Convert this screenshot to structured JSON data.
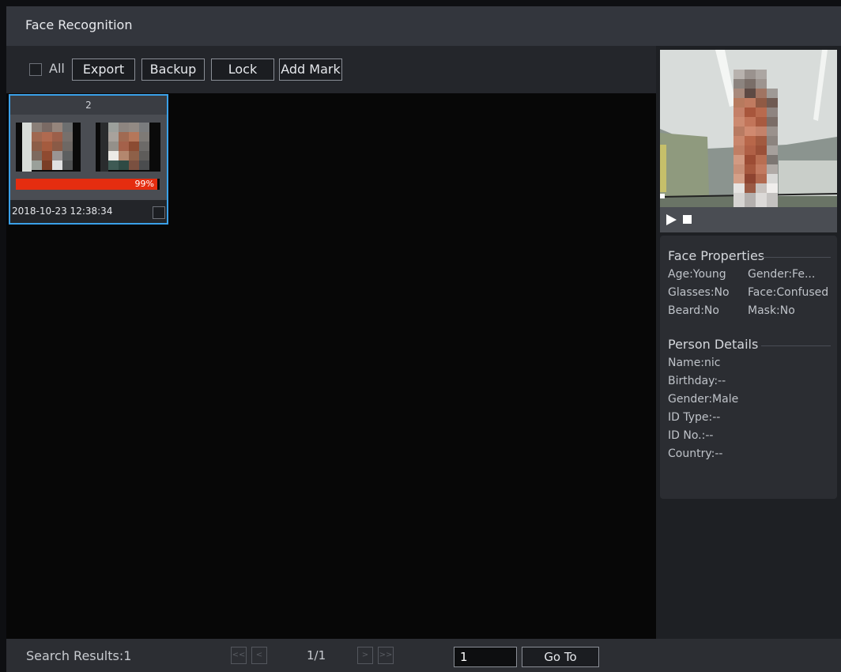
{
  "header": {
    "title": "Face Recognition"
  },
  "toolbar": {
    "all_label": "All",
    "export_label": "Export",
    "backup_label": "Backup",
    "lock_label": "Lock",
    "add_mark_label": "Add Mark"
  },
  "results": {
    "cards": [
      {
        "index": "2",
        "similarity": "99%",
        "similarity_fraction": 0.99,
        "timestamp": "2018-10-23 12:38:34"
      }
    ]
  },
  "preview": {
    "controls": [
      "play-icon",
      "stop-icon"
    ]
  },
  "face_properties": {
    "title": "Face Properties",
    "age": "Age:Young",
    "gender": "Gender:Fe...",
    "glasses": "Glasses:No",
    "face": "Face:Confused",
    "beard": "Beard:No",
    "mask": "Mask:No"
  },
  "person_details": {
    "title": "Person Details",
    "name": "Name:nic",
    "birthday": "Birthday:--",
    "gender": "Gender:Male",
    "id_type": "ID Type:--",
    "id_no": "ID No.:--",
    "country": "Country:--"
  },
  "footer": {
    "search_results": "Search Results:1",
    "first": "<<",
    "prev": "<",
    "page": "1/1",
    "next": ">",
    "last": ">>",
    "goto_value": "1",
    "goto_label": "Go To"
  },
  "colors": {
    "accent": "#3aa0e8",
    "similarity_bar": "#e52d10"
  }
}
